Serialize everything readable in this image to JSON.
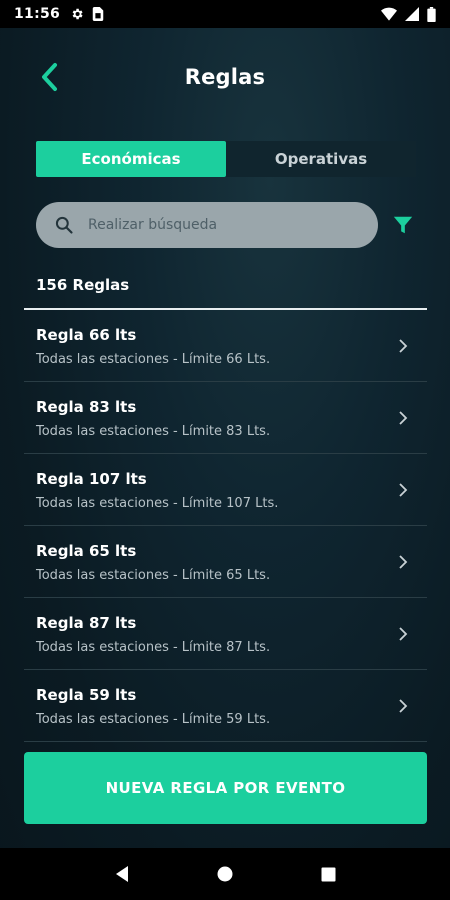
{
  "status_bar": {
    "time": "11:56",
    "left_icons": [
      "gear-icon",
      "sim-card-icon"
    ],
    "right_icons": [
      "wifi-icon",
      "signal-icon",
      "battery-icon"
    ]
  },
  "header": {
    "title": "Reglas",
    "back_icon": "chevron-left-icon"
  },
  "tabs": [
    {
      "label": "Económicas",
      "active": true
    },
    {
      "label": "Operativas",
      "active": false
    }
  ],
  "search": {
    "placeholder": "Realizar búsqueda",
    "value": "",
    "icon": "search-icon"
  },
  "filter_icon": "filter-icon",
  "rules_count": "156 Reglas",
  "rules": [
    {
      "name": "Regla 66 lts",
      "description": "Todas las estaciones - Límite 66 Lts."
    },
    {
      "name": "Regla 83 lts",
      "description": "Todas las estaciones - Límite 83 Lts."
    },
    {
      "name": "Regla 107 lts",
      "description": "Todas las estaciones - Límite 107 Lts."
    },
    {
      "name": "Regla 65 lts",
      "description": "Todas las estaciones - Límite 65 Lts."
    },
    {
      "name": "Regla 87 lts",
      "description": "Todas las estaciones - Límite 87 Lts."
    },
    {
      "name": "Regla 59 lts",
      "description": "Todas las estaciones - Límite 59 Lts."
    }
  ],
  "cta_label": "NUEVA REGLA POR EVENTO",
  "nav_bar": {
    "icons": [
      "back-triangle-icon",
      "home-circle-icon",
      "recents-square-icon"
    ]
  },
  "colors": {
    "accent": "#1ccf9e",
    "background": "#0f2530",
    "search_bg": "#9aa6ab"
  }
}
